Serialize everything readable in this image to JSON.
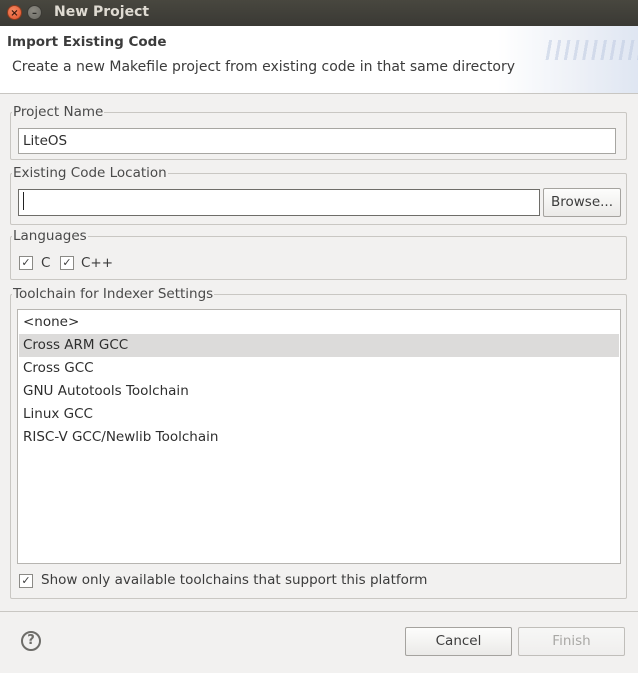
{
  "window": {
    "title": "New Project"
  },
  "banner": {
    "title": "Import Existing Code",
    "description": "Create a new Makefile project from existing code in that same directory"
  },
  "project_name": {
    "label": "Project Name",
    "value": "LiteOS"
  },
  "code_location": {
    "label": "Existing Code Location",
    "value": "",
    "browse_label": "Browse..."
  },
  "languages": {
    "label": "Languages",
    "options": [
      {
        "label": "C",
        "checked": true
      },
      {
        "label": "C++",
        "checked": true
      }
    ]
  },
  "toolchain": {
    "label": "Toolchain for Indexer Settings",
    "items": [
      "<none>",
      "Cross ARM GCC",
      "Cross GCC",
      "GNU Autotools Toolchain",
      "Linux GCC",
      "RISC-V GCC/Newlib Toolchain"
    ],
    "selected": "Cross ARM GCC",
    "filter_label": "Show only available toolchains that support this platform",
    "filter_checked": true
  },
  "footer": {
    "cancel_label": "Cancel",
    "finish_label": "Finish",
    "finish_enabled": false
  },
  "icons": {
    "close": "close-icon",
    "minimize": "minimize-icon",
    "help": "help-icon",
    "check": "check-icon"
  },
  "colors": {
    "titlebar": "#3c3b37",
    "close_button": "#e9643b",
    "selection": "#dcdbda"
  }
}
